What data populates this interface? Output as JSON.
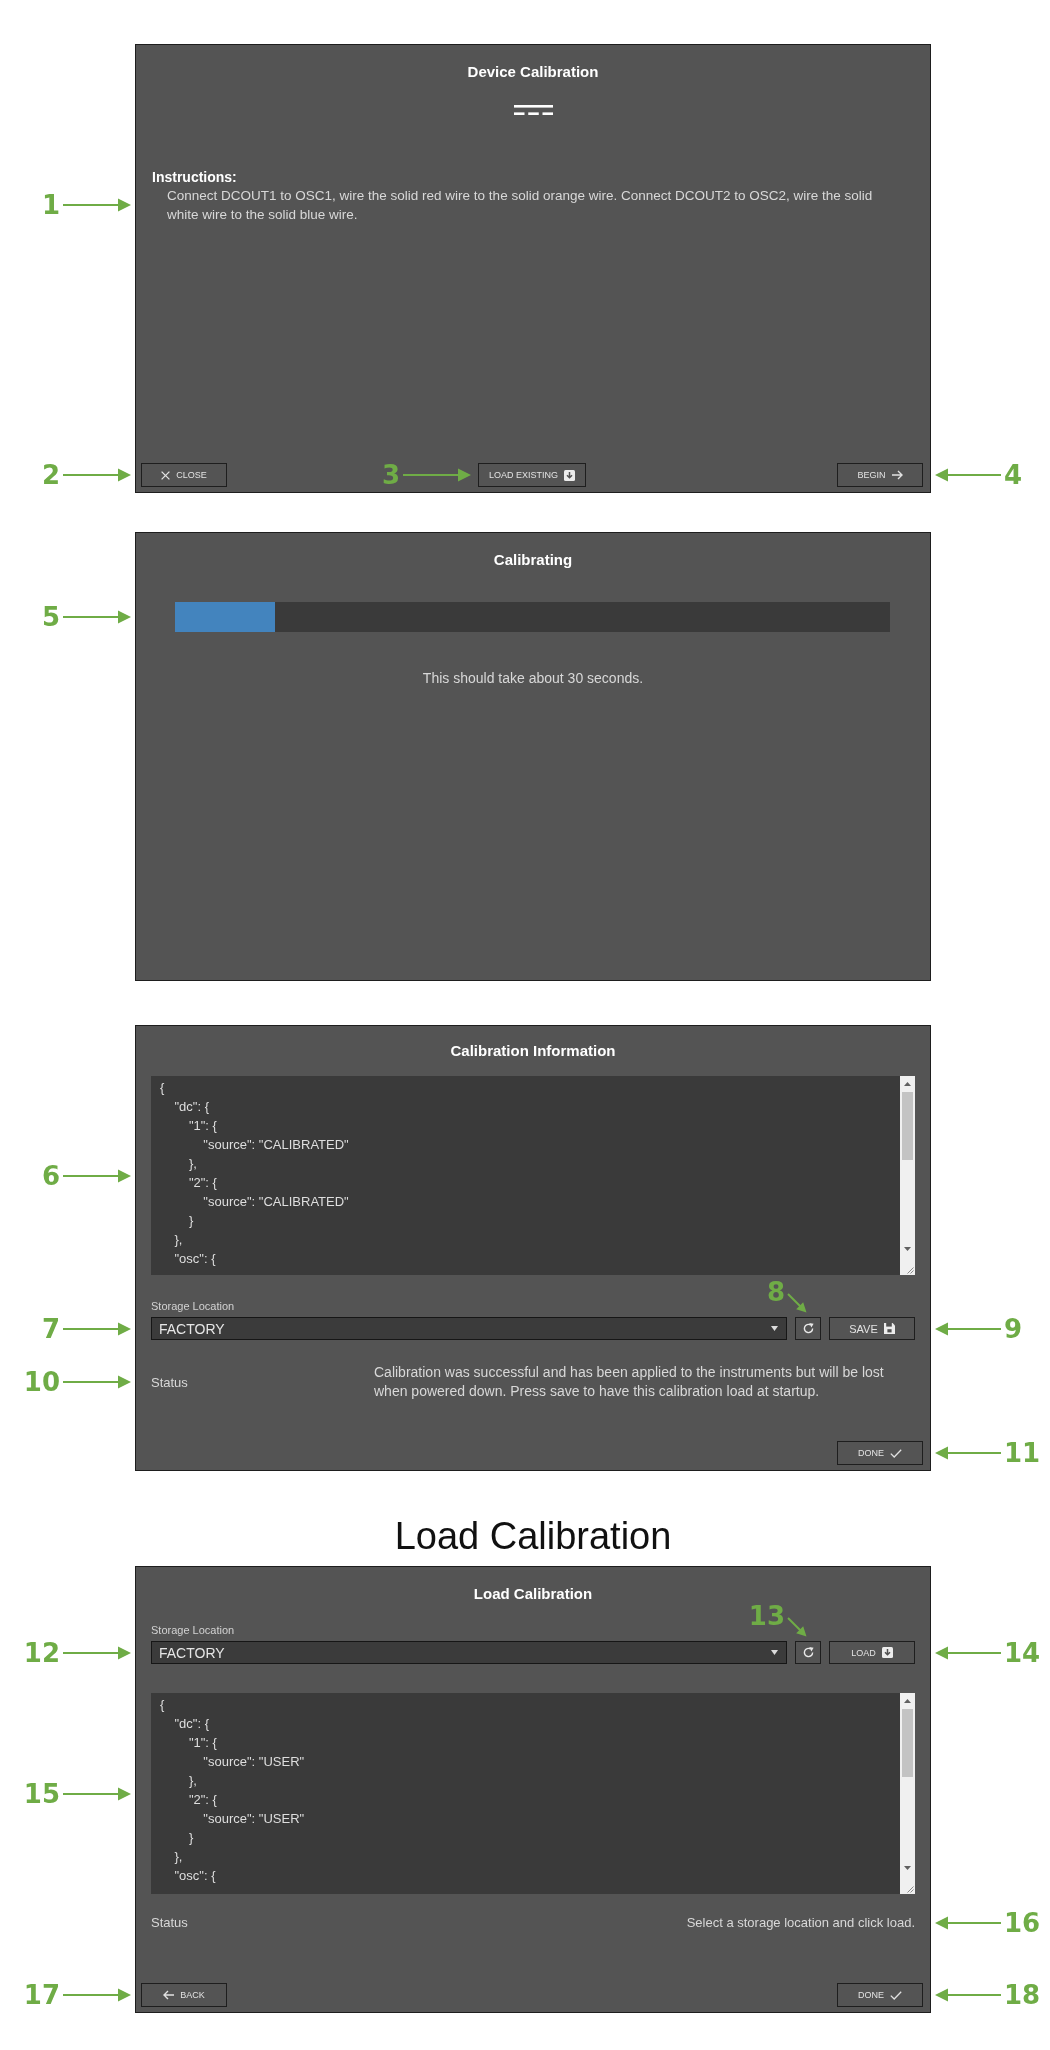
{
  "figure": [
    {
      "kind": "instructions",
      "title": "Device Calibration",
      "heading": "Instructions:",
      "text": "Connect DCOUT1 to OSC1, wire the solid red wire to the solid orange wire. Connect DCOUT2 to OSC2, wire the solid white wire to the solid blue wire.",
      "callout": "1",
      "buttons": [
        {
          "kind": "close",
          "label": "CLOSE",
          "callout": "2"
        },
        {
          "kind": "load",
          "label": "LOAD EXISTING",
          "callout": "3"
        },
        {
          "kind": "begin",
          "label": "BEGIN",
          "callout": "4"
        }
      ]
    },
    {
      "kind": "progress",
      "title": "Calibrating",
      "progress": {
        "level": 0.14,
        "callout": "5"
      },
      "message": "This should take about 30 seconds."
    },
    {
      "kind": "info",
      "title": "Calibration Information",
      "editor": {
        "text": "{\n    \"dc\": {\n        \"1\": {\n            \"source\": \"CALIBRATED\"\n        },\n        \"2\": {\n            \"source\": \"CALIBRATED\"\n        }\n    },\n    \"osc\": {",
        "callout": "6"
      },
      "storage": {
        "label": "Storage Location",
        "value": "FACTORY",
        "callout": "7",
        "refresh_callout": "8",
        "action": {
          "kind": "save",
          "label": "SAVE",
          "callout": "9"
        }
      },
      "status": {
        "label": "Status",
        "message": "Calibration was successful and has been applied to the instruments but will be lost when powered down. Press save to have this calibration load at startup.",
        "callout": "10"
      },
      "buttons": [
        {
          "kind": "done",
          "label": "DONE",
          "callout": "11"
        }
      ]
    },
    {
      "kind": "heading",
      "text": "Load Calibration"
    },
    {
      "kind": "load",
      "title": "Load Calibration",
      "storage": {
        "label": "Storage Location",
        "value": "FACTORY",
        "callout": "12",
        "refresh_callout": "13",
        "action": {
          "kind": "load",
          "label": "LOAD",
          "callout": "14"
        }
      },
      "editor": {
        "text": "{\n    \"dc\": {\n        \"1\": {\n            \"source\": \"USER\"\n        },\n        \"2\": {\n            \"source\": \"USER\"\n        }\n    },\n    \"osc\": {",
        "callout": "15"
      },
      "status": {
        "label": "Status",
        "message": "Select a storage location and click load.",
        "callout": "16"
      },
      "buttons": [
        {
          "kind": "back",
          "label": "BACK",
          "callout": "17"
        },
        {
          "kind": "done",
          "label": "DONE",
          "callout": "18"
        }
      ]
    }
  ]
}
